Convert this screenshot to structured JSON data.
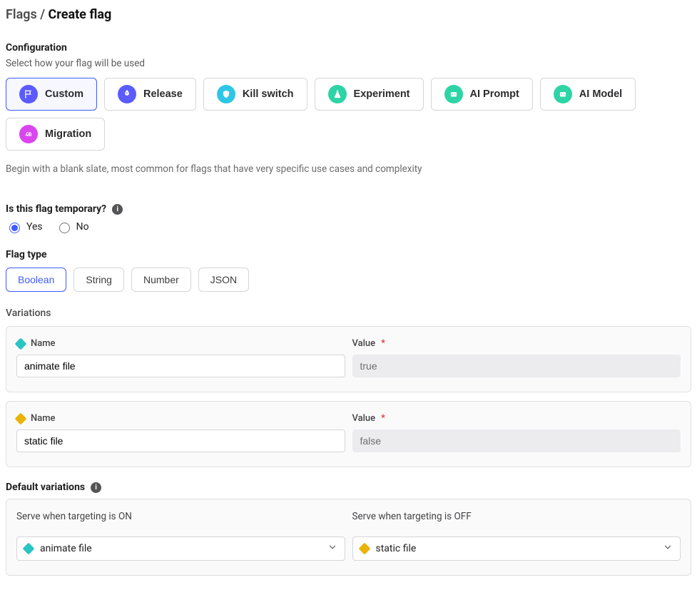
{
  "breadcrumb": {
    "parent": "Flags",
    "sep": " / ",
    "current": "Create flag"
  },
  "config": {
    "title": "Configuration",
    "subtitle": "Select how your flag will be used",
    "options": {
      "custom": {
        "label": "Custom"
      },
      "release": {
        "label": "Release"
      },
      "kill": {
        "label": "Kill switch"
      },
      "experiment": {
        "label": "Experiment"
      },
      "ai_prompt": {
        "label": "AI Prompt"
      },
      "ai_model": {
        "label": "AI Model"
      },
      "migration": {
        "label": "Migration"
      }
    },
    "description": "Begin with a blank slate, most common for flags that have very specific use cases and complexity"
  },
  "temporary": {
    "question": "Is this flag temporary?",
    "yes": "Yes",
    "no": "No",
    "selected": "yes"
  },
  "flagtype": {
    "title": "Flag type",
    "opts": {
      "boolean": "Boolean",
      "string": "String",
      "number": "Number",
      "json": "JSON"
    }
  },
  "variations": {
    "title": "Variations",
    "nameLabel": "Name",
    "valueLabel": "Value",
    "rows": [
      {
        "name": "animate file",
        "value": "true",
        "color": "teal"
      },
      {
        "name": "static file",
        "value": "false",
        "color": "amber"
      }
    ]
  },
  "defaults": {
    "title": "Default variations",
    "on": {
      "label": "Serve when targeting is ON",
      "value": "animate file",
      "color": "teal"
    },
    "off": {
      "label": "Serve when targeting is OFF",
      "value": "static file",
      "color": "amber"
    }
  }
}
